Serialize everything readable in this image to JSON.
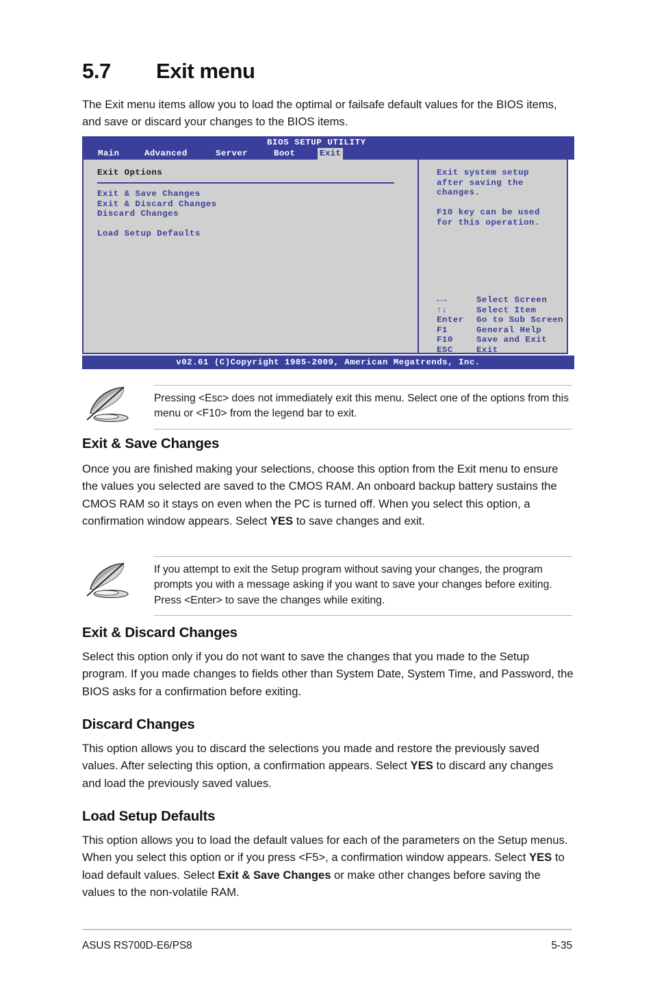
{
  "section": {
    "number": "5.7",
    "title": "Exit menu",
    "intro": "The Exit menu items allow you to load the optimal or failsafe default values for the BIOS items, and save or discard your changes to the BIOS items."
  },
  "bios": {
    "title": "BIOS SETUP UTILITY",
    "tabs": [
      {
        "label": "Main",
        "selected": false
      },
      {
        "label": "Advanced",
        "selected": false
      },
      {
        "label": "Server",
        "selected": false
      },
      {
        "label": "Boot",
        "selected": false
      },
      {
        "label": "Exit",
        "selected": true
      }
    ],
    "panel_heading": "Exit Options",
    "options": [
      "Exit & Save Changes",
      "Exit & Discard Changes",
      "Discard Changes",
      "Load Setup Defaults"
    ],
    "help": {
      "line1": "Exit system setup",
      "line2": "after saving the",
      "line3": "changes.",
      "line4": "F10 key can be used",
      "line5": "for this operation."
    },
    "legend": [
      {
        "key": "←→",
        "desc": "Select Screen"
      },
      {
        "key": "↑↓",
        "desc": "Select Item"
      },
      {
        "key": "Enter",
        "desc": "Go to Sub Screen"
      },
      {
        "key": "F1",
        "desc": "General Help"
      },
      {
        "key": "F10",
        "desc": "Save and Exit"
      },
      {
        "key": "ESC",
        "desc": "Exit"
      }
    ],
    "footer": "v02.61 (C)Copyright 1985-2009, American Megatrends, Inc.",
    "colors": {
      "header_bar": "#3a3f9c",
      "body_bg": "#d0d0d0",
      "option_text": "#3a3f9c",
      "selected_tab_bg": "#d0d0d0"
    }
  },
  "notes": {
    "note1": "Pressing <Esc> does not immediately exit this menu. Select one of the options from this menu or <F10> from the legend bar to exit.",
    "note2": "If you attempt to exit the Setup program without saving your changes, the program prompts you with a message asking if you want to save your changes before exiting. Press <Enter> to save the changes while exiting."
  },
  "sections": {
    "exit_save": {
      "heading": "Exit & Save Changes",
      "body_1": "Once you are finished making your selections, choose this option from the Exit menu to ensure the values you selected are saved to the CMOS RAM. An onboard backup battery sustains the CMOS RAM so it stays on even when the PC is turned off. When you select this option, a confirmation window appears. Select ",
      "body_bold_1": "YES",
      "body_2": " to save changes and exit."
    },
    "exit_discard": {
      "heading": "Exit & Discard Changes",
      "body": "Select this option only if you do not want to save the changes that you made to the Setup program. If you made changes to fields other than System Date, System Time, and Password, the BIOS asks for a confirmation before exiting."
    },
    "discard": {
      "heading": "Discard Changes",
      "body_1": "This option allows you to discard the selections you made and restore the previously saved values. After selecting this option, a confirmation appears. Select ",
      "body_bold_1": "YES",
      "body_2": " to discard any changes and load the previously saved values."
    },
    "load_defaults": {
      "heading": "Load Setup Defaults",
      "body_1": "This option allows you to load the default values for each of the parameters on the Setup menus. When you select this option or if you press <F5>, a confirmation window appears. Select ",
      "body_bold_1": "YES",
      "body_2": " to load default values. Select ",
      "body_bold_2": "Exit & Save Changes",
      "body_3": " or make other changes before saving the values to the non-volatile RAM."
    }
  },
  "footer": {
    "product": "ASUS RS700D-E6/PS8",
    "page": "5-35"
  }
}
